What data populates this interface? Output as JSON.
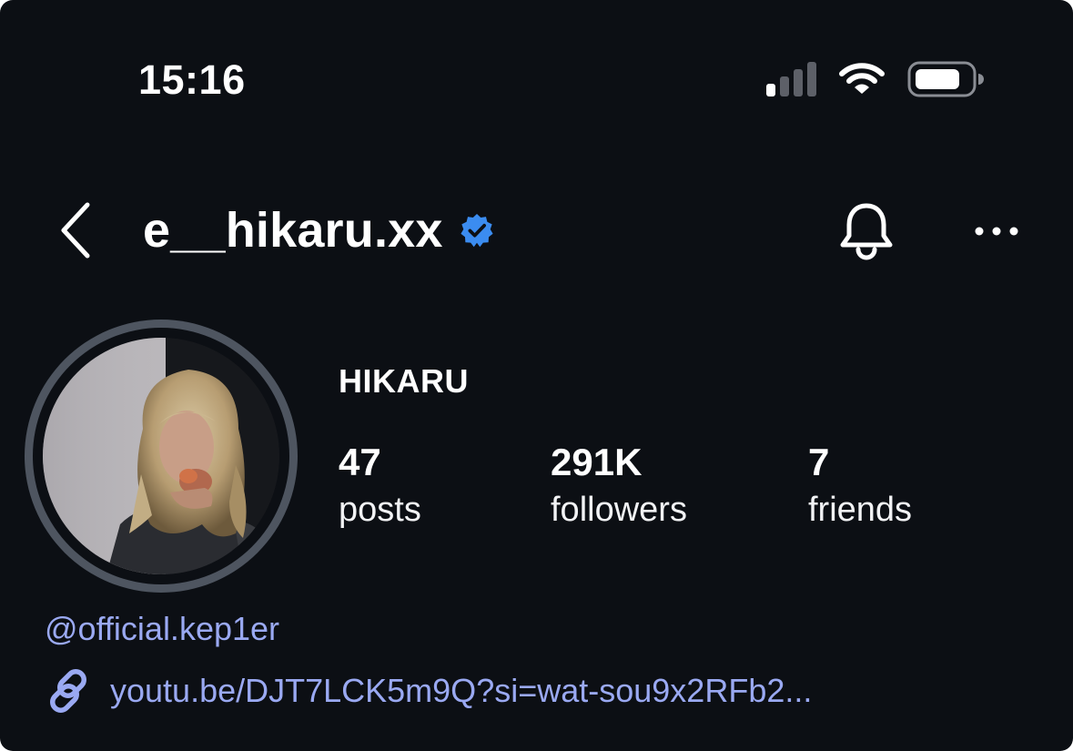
{
  "status_bar": {
    "time": "15:16",
    "signal_bars_on": 1,
    "signal_bars_total": 4,
    "battery_icon": "battery-icon",
    "wifi_icon": "wifi-icon"
  },
  "header": {
    "back_icon": "chevron-left-icon",
    "username": "e__hikaru.xx",
    "verified_icon": "verified-badge-icon",
    "bell_icon": "bell-icon",
    "more_icon": "more-horizontal-icon"
  },
  "profile": {
    "display_name": "HIKARU",
    "stats": [
      {
        "value": "47",
        "label": "posts"
      },
      {
        "value": "291K",
        "label": "followers"
      },
      {
        "value": "7",
        "label": "friends"
      }
    ]
  },
  "bio": {
    "mention": "@official.kep1er",
    "link_icon": "link-icon",
    "link": "youtu.be/DJT7LCK5m9Q?si=wat-sou9x2RFb2..."
  },
  "colors": {
    "background": "#0c0f14",
    "text": "#ffffff",
    "link": "#9aa9f2",
    "verified": "#3b8cf0",
    "avatar_ring": "#4e5560"
  }
}
